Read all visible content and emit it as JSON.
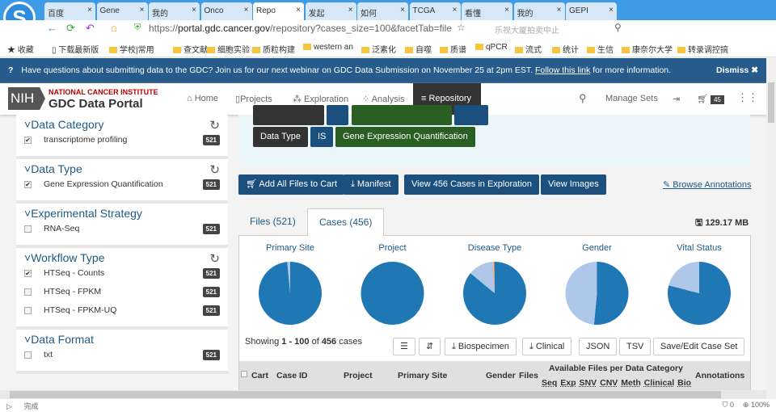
{
  "browser": {
    "tabs": [
      "百度",
      "Gene",
      "我的",
      "Onco",
      "Repo",
      "发起",
      "如何",
      "TCGA",
      "看懂",
      "我的",
      "GEPI"
    ],
    "active_tab": 4,
    "url_prefix": "https://",
    "url_host": "portal.gdc.cancer.gov",
    "url_path": "/repository?cases_size=100&facetTab=file",
    "search_placeholder": "乐视大厦拍卖中止",
    "bookmarks": [
      "收藏",
      "下载最新版",
      "学校|常用",
      "查文献",
      "细胞实验",
      "质粒构建",
      "western an",
      "泛素化",
      "自噬",
      "质谱",
      "qPCR",
      "流式",
      "统计",
      "生信",
      "康奈尔大学",
      "转录调控搞"
    ],
    "status_text": "完成",
    "zoom": "100%",
    "blocked_count": "0"
  },
  "banner": {
    "text": "Have questions about submitting data to the GDC? Join us for our next webinar on GDC Data Submission on November 25 at 2pm EST. ",
    "link": "Follow this link",
    "suffix": " for more information.",
    "dismiss": "Dismiss ✖"
  },
  "header": {
    "nci": "NATIONAL CANCER INSTITUTE",
    "portal": "GDC Data Portal",
    "nih": "NIH",
    "nav": [
      "Home",
      "Projects",
      "Exploration",
      "Analysis"
    ],
    "active_nav": "Repository",
    "manage_sets": "Manage Sets",
    "cart_count": "45"
  },
  "facets": [
    {
      "title": "Data Category",
      "reset": true,
      "items": [
        {
          "label": "transcriptome profiling",
          "checked": true,
          "count": "521"
        }
      ]
    },
    {
      "title": "Data Type",
      "reset": true,
      "items": [
        {
          "label": "Gene Expression Quantification",
          "checked": true,
          "count": "521"
        }
      ]
    },
    {
      "title": "Experimental Strategy",
      "reset": false,
      "items": [
        {
          "label": "RNA-Seq",
          "checked": false,
          "count": "521"
        }
      ]
    },
    {
      "title": "Workflow Type",
      "reset": true,
      "items": [
        {
          "label": "HTSeq - Counts",
          "checked": true,
          "count": "521"
        },
        {
          "label": "HTSeq - FPKM",
          "checked": false,
          "count": "521"
        },
        {
          "label": "HTSeq - FPKM-UQ",
          "checked": false,
          "count": "521"
        }
      ]
    },
    {
      "title": "Data Format",
      "reset": false,
      "items": [
        {
          "label": "txt",
          "checked": false,
          "count": "521"
        }
      ]
    }
  ],
  "query": {
    "field": "Data Type",
    "op": "IS",
    "value": "Gene Expression Quantification"
  },
  "actions": {
    "add_all": "Add All Files to Cart",
    "manifest": "Manifest",
    "view_cases": "View 456 Cases in Exploration",
    "view_images": "View Images",
    "browse_annotations": "Browse Annotations"
  },
  "tabs": {
    "files": "Files (521)",
    "cases": "Cases (456)",
    "size": "129.17 MB"
  },
  "chart_data": [
    {
      "type": "pie",
      "title": "Primary Site",
      "values": [
        0.985,
        0.015
      ]
    },
    {
      "type": "pie",
      "title": "Project",
      "values": [
        1.0
      ]
    },
    {
      "type": "pie",
      "title": "Disease Type",
      "values": [
        0.86,
        0.135,
        0.005
      ]
    },
    {
      "type": "pie",
      "title": "Gender",
      "values": [
        0.515,
        0.485
      ]
    },
    {
      "type": "pie",
      "title": "Vital Status",
      "values": [
        0.79,
        0.21
      ]
    }
  ],
  "pie_colors": [
    "#1f77b4",
    "#aec7e8",
    "#ff7f0e"
  ],
  "table": {
    "showing_prefix": "Showing ",
    "range": "1 - 100",
    "of": " of ",
    "total": "456",
    "suffix": " cases",
    "buttons": [
      "Biospecimen",
      "Clinical",
      "JSON",
      "TSV",
      "Save/Edit Case Set"
    ],
    "columns": [
      "Cart",
      "Case ID",
      "Project",
      "Primary Site",
      "Gender",
      "Files"
    ],
    "group_header": "Available Files per Data Category",
    "sub_columns": [
      "Seq",
      "Exp",
      "SNV",
      "CNV",
      "Meth",
      "Clinical",
      "Bio"
    ],
    "annotations": "Annotations"
  }
}
